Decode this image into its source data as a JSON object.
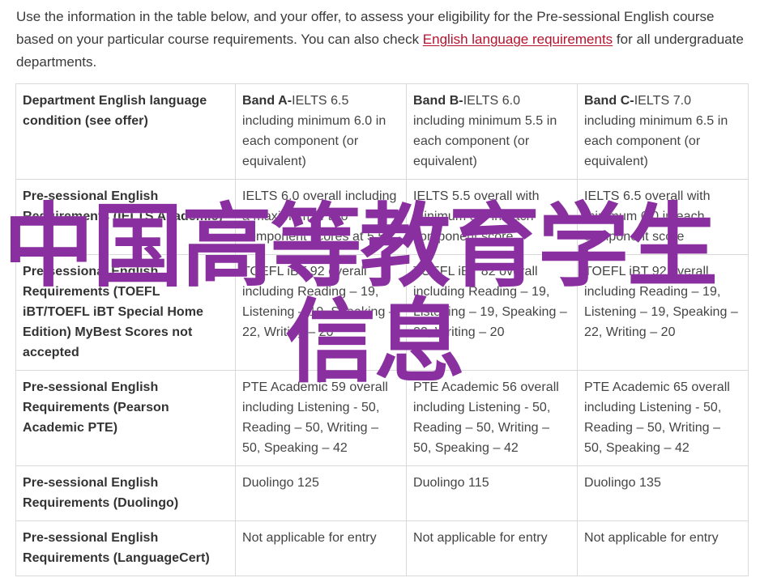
{
  "intro": {
    "text_before_link": "Use the information in the table below, and your offer, to assess your eligibility for the Pre-sessional English course based on your particular course requirements. You can also check ",
    "link_text": "English language requirements",
    "text_after_link": " for all undergraduate departments."
  },
  "table": {
    "header": {
      "condition_label": "Department English language condition (see offer)",
      "bands": [
        {
          "label": "Band A-",
          "text": "IELTS 6.5 including minimum 6.0 in each component (or equivalent)"
        },
        {
          "label": "Band B-",
          "text": "IELTS 6.0 including minimum 5.5 in each component (or equivalent)"
        },
        {
          "label": "Band C-",
          "text": "IELTS 7.0 including minimum 6.5 in each component (or equivalent)"
        }
      ]
    },
    "rows": [
      {
        "label": "Pre-sessional English Requirements (IELTS Academic)",
        "cells": [
          "IELTS 6.0 overall including a maximum of two component scores at 5.5",
          "IELTS 5.5 overall with minimum 5.5 in each component score",
          "IELTS 6.5 overall with minimum 6.0 in each component score"
        ]
      },
      {
        "label": "Pre-sessional English Requirements (TOEFL iBT/TOEFL iBT Special Home Edition) MyBest Scores not accepted",
        "cells": [
          "TOEFL iBT 92 overall including Reading – 19, Listening – 19, Speaking – 22, Writing – 20",
          "TOEFL iBT 82 overall including Reading – 19, Listening – 19, Speaking – 22, Writing – 20",
          "TOEFL iBT 92 overall including Reading – 19, Listening – 19, Speaking – 22, Writing – 20"
        ]
      },
      {
        "label": "Pre-sessional English Requirements (Pearson Academic PTE)",
        "cells": [
          "PTE Academic 59 overall including Listening - 50, Reading – 50, Writing – 50, Speaking – 42",
          "PTE Academic 56 overall including Listening - 50, Reading – 50, Writing – 50, Speaking – 42",
          "PTE Academic 65 overall including Listening - 50, Reading – 50, Writing – 50, Speaking – 42"
        ]
      },
      {
        "label": "Pre-sessional English Requirements (Duolingo)",
        "cells": [
          "Duolingo 125",
          "Duolingo 115",
          "Duolingo 135"
        ]
      },
      {
        "label": "Pre-sessional English Requirements (LanguageCert)",
        "cells": [
          "Not applicable for entry",
          "Not applicable for entry",
          "Not applicable for entry"
        ]
      }
    ]
  },
  "watermark": {
    "line1": "中国高等教育学生",
    "line2": "信息",
    "color": "#8a2fa0"
  },
  "colors": {
    "link": "#b5122d",
    "border": "#d9d9d9",
    "text": "#444444"
  }
}
